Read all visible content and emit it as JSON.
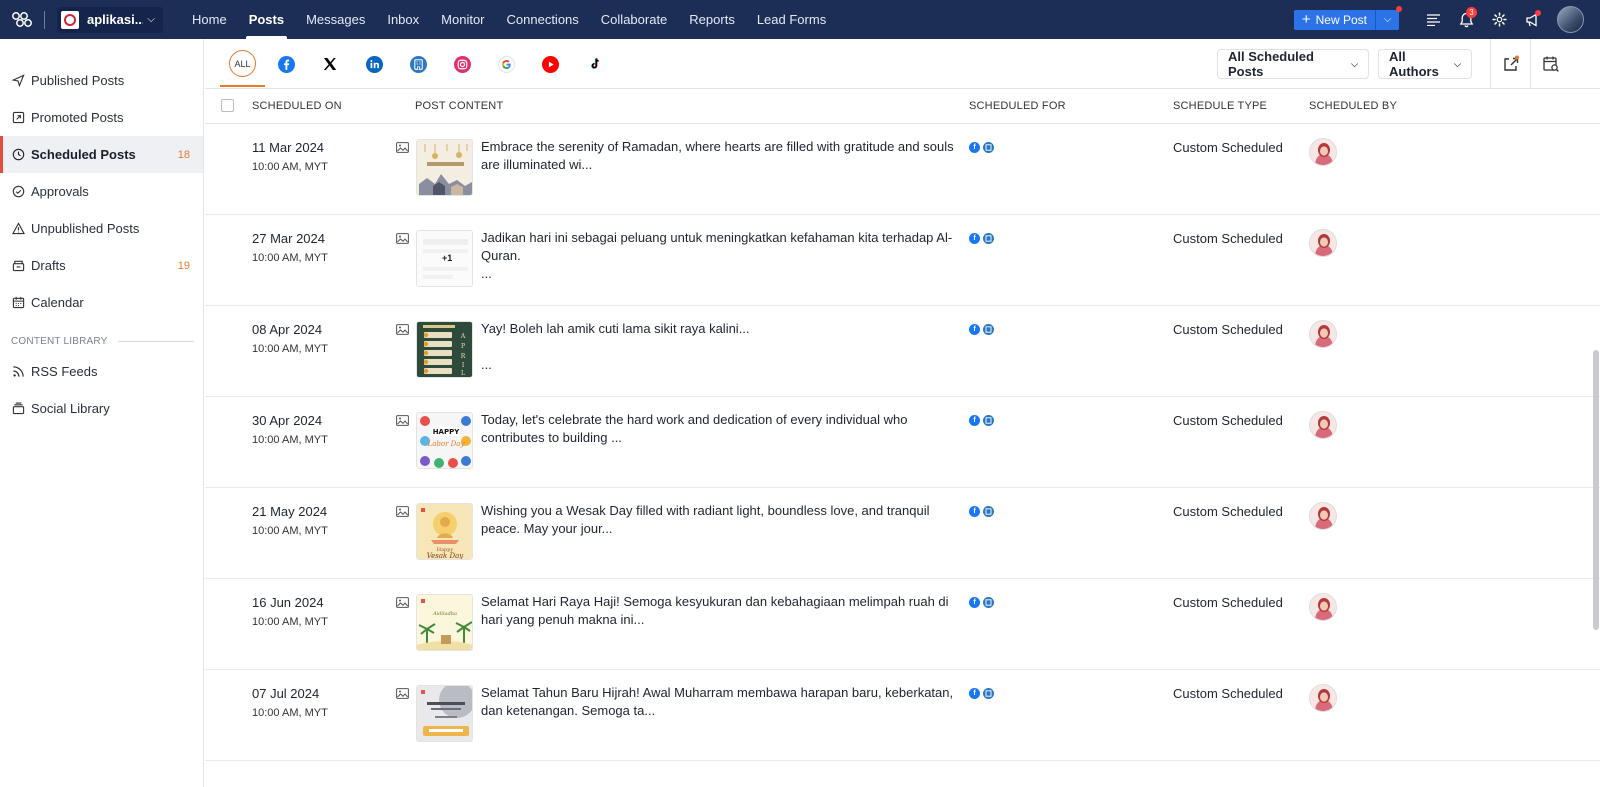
{
  "topbar": {
    "brand_name": "aplikasi...",
    "nav": [
      {
        "label": "Home",
        "active": false
      },
      {
        "label": "Posts",
        "active": true
      },
      {
        "label": "Messages",
        "active": false
      },
      {
        "label": "Inbox",
        "active": false
      },
      {
        "label": "Monitor",
        "active": false
      },
      {
        "label": "Connections",
        "active": false
      },
      {
        "label": "Collaborate",
        "active": false
      },
      {
        "label": "Reports",
        "active": false
      },
      {
        "label": "Lead Forms",
        "active": false
      }
    ],
    "new_post_label": "New Post",
    "notification_count": "3"
  },
  "sidebar": {
    "items": [
      {
        "label": "Published Posts",
        "icon": "send-icon",
        "count": ""
      },
      {
        "label": "Promoted Posts",
        "icon": "promote-icon",
        "count": ""
      },
      {
        "label": "Scheduled Posts",
        "icon": "clock-icon",
        "count": "18",
        "active": true
      },
      {
        "label": "Approvals",
        "icon": "check-circle-icon",
        "count": ""
      },
      {
        "label": "Unpublished Posts",
        "icon": "warning-icon",
        "count": ""
      },
      {
        "label": "Drafts",
        "icon": "drafts-icon",
        "count": "19"
      },
      {
        "label": "Calendar",
        "icon": "calendar-icon",
        "count": ""
      }
    ],
    "library_title": "CONTENT LIBRARY",
    "library_items": [
      {
        "label": "RSS Feeds",
        "icon": "rss-icon"
      },
      {
        "label": "Social Library",
        "icon": "library-icon"
      }
    ]
  },
  "filters": {
    "all_label": "ALL",
    "networks": [
      "facebook",
      "x",
      "linkedin",
      "google-business",
      "instagram",
      "google",
      "youtube",
      "tiktok"
    ],
    "posts_dropdown": "All Scheduled Posts",
    "authors_dropdown": "All Authors"
  },
  "table": {
    "headers": {
      "scheduled_on": "SCHEDULED ON",
      "post_content": "POST CONTENT",
      "scheduled_for": "SCHEDULED FOR",
      "schedule_type": "SCHEDULE TYPE",
      "scheduled_by": "SCHEDULED BY"
    },
    "rows": [
      {
        "date": "11 Mar 2024",
        "time": "10:00 AM, MYT",
        "text": "Embrace the serenity of Ramadan, where hearts are filled with gratitude and souls are illuminated wi...",
        "type": "Custom Scheduled",
        "thumb": "ramadan"
      },
      {
        "date": "27 Mar 2024",
        "time": "10:00 AM, MYT",
        "text": "Jadikan hari ini sebagai peluang untuk meningkatkan kefahaman kita terhadap Al-Quran.\n...",
        "type": "Custom Scheduled",
        "thumb": "plus1",
        "thumb_label": "+1"
      },
      {
        "date": "08 Apr 2024",
        "time": "10:00 AM, MYT",
        "text": "Yay! Boleh lah amik cuti lama sikit raya kalini...\n\n...",
        "type": "Custom Scheduled",
        "thumb": "april"
      },
      {
        "date": "30 Apr 2024",
        "time": "10:00 AM, MYT",
        "text": "Today, let's celebrate the hard work and dedication of every individual who contributes to building ...",
        "type": "Custom Scheduled",
        "thumb": "labour"
      },
      {
        "date": "21 May 2024",
        "time": "10:00 AM, MYT",
        "text": "Wishing you a Wesak Day filled with radiant light, boundless love, and tranquil peace. May your jour...",
        "type": "Custom Scheduled",
        "thumb": "wesak"
      },
      {
        "date": "16 Jun 2024",
        "time": "10:00 AM, MYT",
        "text": "Selamat Hari Raya Haji! Semoga kesyukuran dan kebahagiaan melimpah ruah di hari yang penuh makna ini...",
        "type": "Custom Scheduled",
        "thumb": "haji"
      },
      {
        "date": "07 Jul 2024",
        "time": "10:00 AM, MYT",
        "text": "Selamat Tahun Baru Hijrah! Awal Muharram membawa harapan baru, keberkatan, dan ketenangan. Semoga ta...",
        "type": "Custom Scheduled",
        "thumb": "hijrah"
      }
    ]
  },
  "colors": {
    "topbar": "#1c2e56",
    "accent": "#e8782a",
    "primary": "#2d73e8"
  }
}
